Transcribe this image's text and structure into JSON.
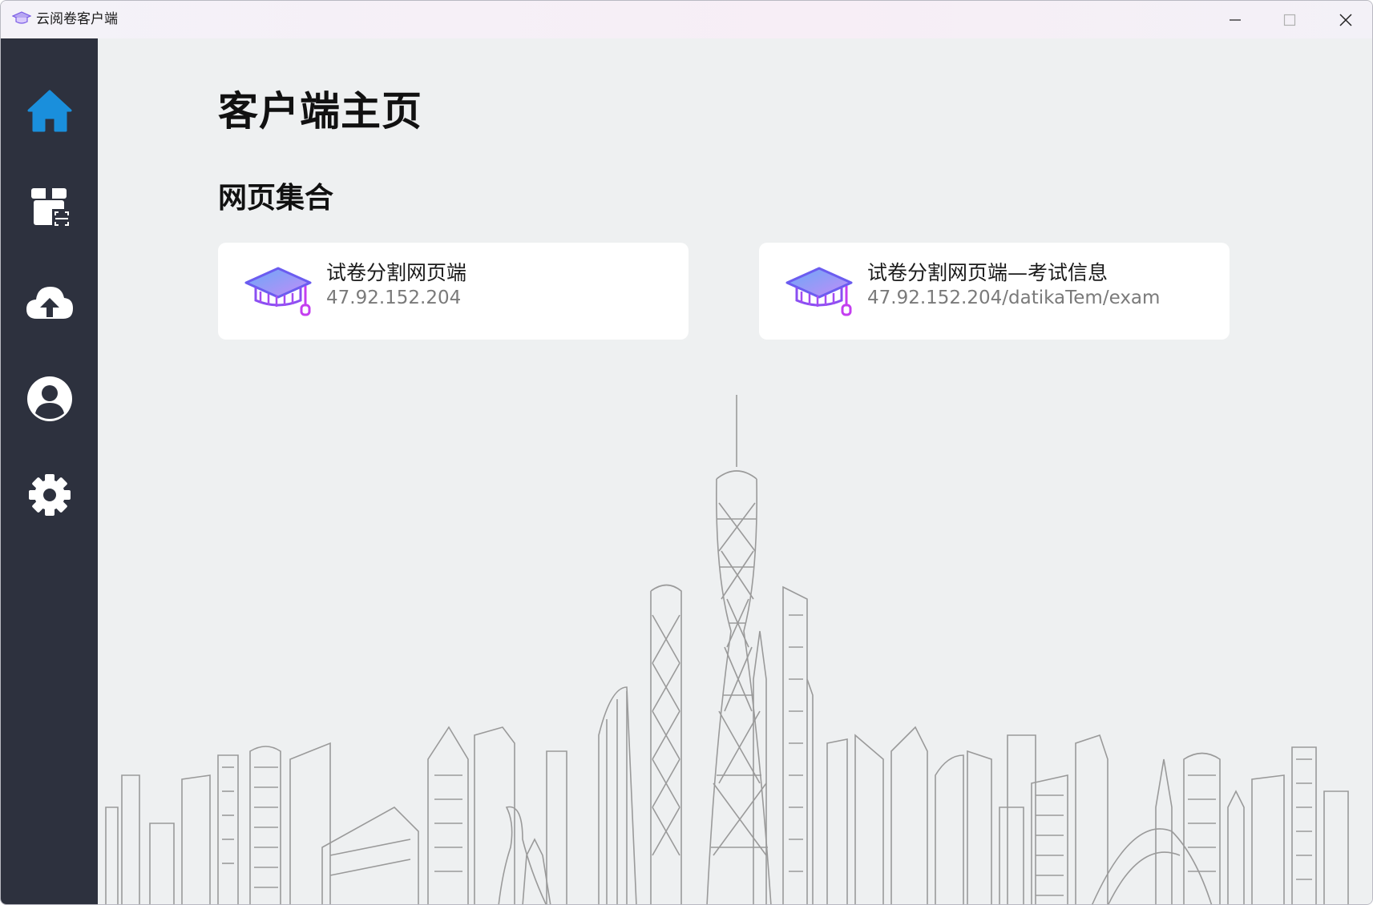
{
  "window": {
    "title": "云阅卷客户端",
    "app_icon": "graduation-cap-icon",
    "controls": [
      "minimize-icon",
      "maximize-icon",
      "close-icon"
    ]
  },
  "sidebar": {
    "background": "#2d313e",
    "items": [
      {
        "icon": "home-icon",
        "active": true,
        "color": "#1a8fdc"
      },
      {
        "icon": "package-scan-icon",
        "active": false
      },
      {
        "icon": "cloud-upload-icon",
        "active": false
      },
      {
        "icon": "user-avatar-icon",
        "active": false
      },
      {
        "icon": "gear-icon",
        "active": false
      }
    ]
  },
  "main": {
    "page_title": "客户端主页",
    "section_title": "网页集合",
    "cards": [
      {
        "icon": "graduation-cap-icon",
        "name": "试卷分割网页端",
        "url": "47.92.152.204"
      },
      {
        "icon": "graduation-cap-icon",
        "name": "试卷分割网页端—考试信息",
        "url": "47.92.152.204/datikaTem/exam"
      }
    ],
    "background_image": "city-skyline-illustration"
  },
  "colors": {
    "accent": "#1a8fdc",
    "cap_purple": "#9b3cf0",
    "cap_blue": "#5a8cf5",
    "content_bg": "#eef0f1"
  }
}
